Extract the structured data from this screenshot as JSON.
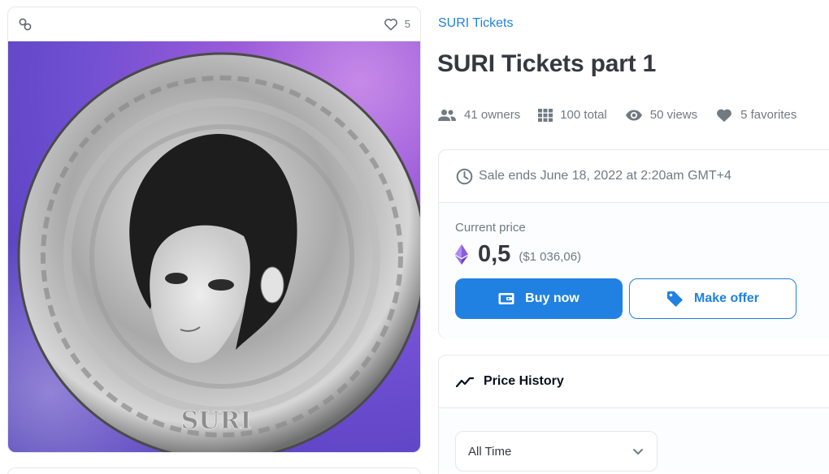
{
  "media": {
    "favorites_count": "5",
    "image_alt": "SURI",
    "coin_text": "SURI",
    "colors": {
      "bg_light": "#c68ae8",
      "bg_dark": "#4b3ab5",
      "coin": "#b8b8b8"
    }
  },
  "item": {
    "collection_name": "SURI Tickets",
    "title": "SURI Tickets part 1"
  },
  "stats": {
    "owners": "41 owners",
    "total": "100 total",
    "views": "50 views",
    "favorites": "5 favorites"
  },
  "sale": {
    "ends_text": "Sale ends June 18, 2022 at 2:20am GMT+4"
  },
  "price": {
    "label": "Current price",
    "value": "0,5",
    "fiat": "($1 036,06)"
  },
  "actions": {
    "buy_label": "Buy now",
    "offer_label": "Make offer"
  },
  "price_history": {
    "title": "Price History",
    "time_filter": "All Time"
  },
  "colors": {
    "accent": "#2081e2",
    "text_primary": "#353840",
    "text_secondary": "#707a83",
    "eth_purple": "#6a3ec7"
  }
}
